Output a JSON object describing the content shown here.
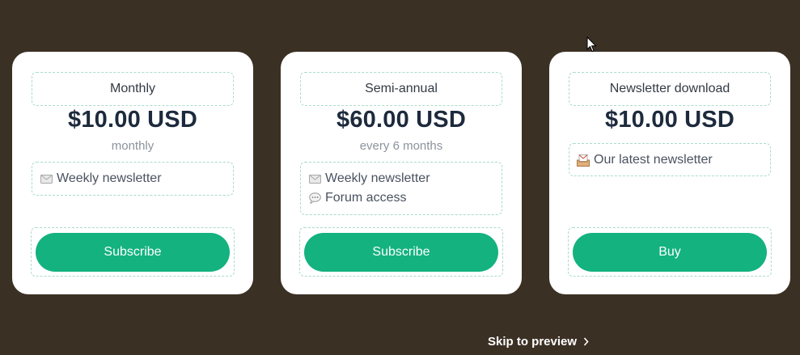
{
  "plans": [
    {
      "name": "Monthly",
      "price": "$10.00 USD",
      "period": "monthly",
      "features": [
        {
          "icon": "envelope-icon",
          "label": "Weekly newsletter"
        }
      ],
      "button": "Subscribe"
    },
    {
      "name": "Semi-annual",
      "price": "$60.00 USD",
      "period": "every 6 months",
      "features": [
        {
          "icon": "envelope-icon",
          "label": "Weekly newsletter"
        },
        {
          "icon": "speech-bubble-icon",
          "label": "Forum access"
        }
      ],
      "button": "Subscribe"
    },
    {
      "name": "Newsletter download",
      "price": "$10.00 USD",
      "features": [
        {
          "icon": "inbox-envelope-icon",
          "label": "Our latest newsletter"
        }
      ],
      "button": "Buy"
    }
  ],
  "skip_link": "Skip to preview",
  "colors": {
    "background": "#3b3024",
    "card": "#ffffff",
    "accent": "#13b27f",
    "price_text": "#1d2a3d"
  }
}
